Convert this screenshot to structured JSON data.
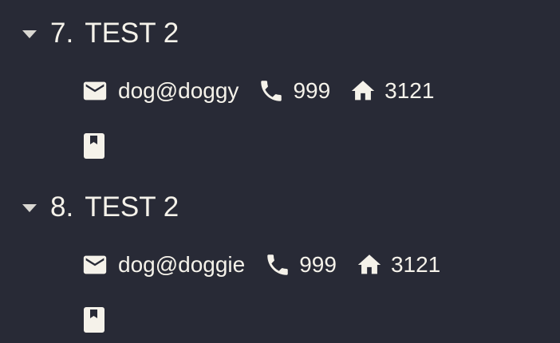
{
  "colors": {
    "background": "#282a36",
    "text": "#f5f2ea",
    "triangle": "#d9d7d2"
  },
  "entries": [
    {
      "index": "7.",
      "name": "TEST 2",
      "email": "dog@doggy",
      "phone": "999",
      "address": "3121",
      "icons": {
        "toggle": "chevron-down-icon",
        "email": "mail-icon",
        "phone": "phone-icon",
        "address": "home-icon",
        "note": "bookmark-icon"
      }
    },
    {
      "index": "8.",
      "name": "TEST 2",
      "email": "dog@doggie",
      "phone": "999",
      "address": "3121",
      "icons": {
        "toggle": "chevron-down-icon",
        "email": "mail-icon",
        "phone": "phone-icon",
        "address": "home-icon",
        "note": "bookmark-icon"
      }
    }
  ]
}
